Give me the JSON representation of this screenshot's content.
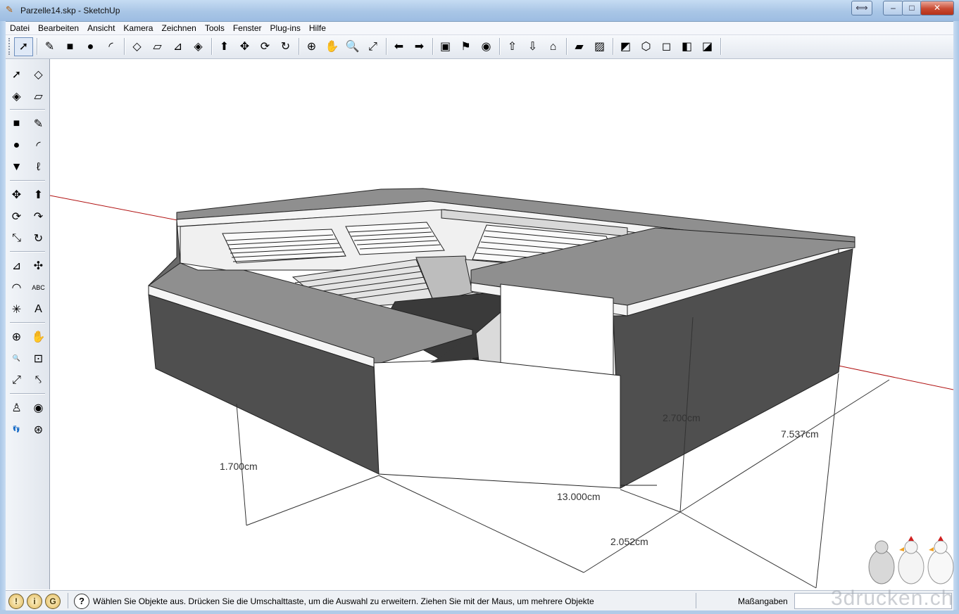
{
  "window": {
    "title": "Parzelle14.skp - SketchUp",
    "extra_button": "⟺",
    "minimize": "–",
    "maximize": "□",
    "close": "✕"
  },
  "menu": [
    "Datei",
    "Bearbeiten",
    "Ansicht",
    "Kamera",
    "Zeichnen",
    "Tools",
    "Fenster",
    "Plug-ins",
    "Hilfe"
  ],
  "toolbar": {
    "groups": [
      [
        {
          "name": "select-tool",
          "glyph": "➚"
        }
      ],
      [
        {
          "name": "pencil-tool",
          "glyph": "✎"
        },
        {
          "name": "rectangle-tool",
          "glyph": "■"
        },
        {
          "name": "circle-tool",
          "glyph": "●"
        },
        {
          "name": "arc-tool",
          "glyph": "◜"
        }
      ],
      [
        {
          "name": "make-component-tool",
          "glyph": "◇"
        },
        {
          "name": "eraser-tool",
          "glyph": "▱"
        },
        {
          "name": "tape-measure-tool",
          "glyph": "⊿"
        },
        {
          "name": "paint-bucket-tool",
          "glyph": "◈"
        }
      ],
      [
        {
          "name": "push-pull-tool",
          "glyph": "⬆"
        },
        {
          "name": "move-tool",
          "glyph": "✥"
        },
        {
          "name": "rotate-tool",
          "glyph": "⟳"
        },
        {
          "name": "offset-tool",
          "glyph": "↻"
        }
      ],
      [
        {
          "name": "orbit-tool",
          "glyph": "⊕"
        },
        {
          "name": "pan-tool",
          "glyph": "✋"
        },
        {
          "name": "zoom-tool",
          "glyph": "🔍"
        },
        {
          "name": "zoom-extents-tool",
          "glyph": "⤢"
        }
      ],
      [
        {
          "name": "previous-view-tool",
          "glyph": "⬅"
        },
        {
          "name": "next-view-tool",
          "glyph": "➡"
        }
      ],
      [
        {
          "name": "get-models-tool",
          "glyph": "▣"
        },
        {
          "name": "add-location-tool",
          "glyph": "⚑"
        },
        {
          "name": "google-earth-tool",
          "glyph": "◉"
        }
      ],
      [
        {
          "name": "share-model-tool",
          "glyph": "⇧"
        },
        {
          "name": "get-components-tool",
          "glyph": "⇩"
        },
        {
          "name": "share-component-tool",
          "glyph": "⌂"
        }
      ],
      [
        {
          "name": "section-plane-tool",
          "glyph": "▰"
        },
        {
          "name": "display-section-tool",
          "glyph": "▨"
        }
      ],
      [
        {
          "name": "xray-style-tool",
          "glyph": "◩"
        },
        {
          "name": "wireframe-style-tool",
          "glyph": "⬡"
        },
        {
          "name": "hidden-line-style-tool",
          "glyph": "◻"
        },
        {
          "name": "shaded-style-tool",
          "glyph": "◧"
        },
        {
          "name": "textured-style-tool",
          "glyph": "◪"
        }
      ]
    ]
  },
  "left_toolbar": [
    {
      "name": "select-tool",
      "glyph": "➚"
    },
    {
      "name": "make-component-tool",
      "glyph": "◇"
    },
    {
      "name": "paint-bucket-tool",
      "glyph": "◈"
    },
    {
      "name": "eraser-tool",
      "glyph": "▱"
    },
    {
      "name": "rectangle-tool",
      "glyph": "■"
    },
    {
      "name": "line-tool",
      "glyph": "✎"
    },
    {
      "name": "circle-tool",
      "glyph": "●"
    },
    {
      "name": "arc-tool",
      "glyph": "◜"
    },
    {
      "name": "polygon-tool",
      "glyph": "▼"
    },
    {
      "name": "freehand-tool",
      "glyph": "ℓ"
    },
    {
      "name": "move-tool",
      "glyph": "✥"
    },
    {
      "name": "push-pull-tool",
      "glyph": "⬆"
    },
    {
      "name": "rotate-tool",
      "glyph": "⟳"
    },
    {
      "name": "follow-me-tool",
      "glyph": "↷"
    },
    {
      "name": "scale-tool",
      "glyph": "⤡"
    },
    {
      "name": "offset-tool",
      "glyph": "↻"
    },
    {
      "name": "tape-measure-tool",
      "glyph": "⊿"
    },
    {
      "name": "dimension-tool",
      "glyph": "✣"
    },
    {
      "name": "protractor-tool",
      "glyph": "◠"
    },
    {
      "name": "text-tool",
      "glyph": "ABC"
    },
    {
      "name": "axes-tool",
      "glyph": "✳"
    },
    {
      "name": "3d-text-tool",
      "glyph": "A"
    },
    {
      "name": "orbit-tool",
      "glyph": "⊕"
    },
    {
      "name": "pan-tool",
      "glyph": "✋"
    },
    {
      "name": "zoom-tool",
      "glyph": "🔍"
    },
    {
      "name": "zoom-window-tool",
      "glyph": "⊡"
    },
    {
      "name": "zoom-extents-tool",
      "glyph": "⤢"
    },
    {
      "name": "previous-tool",
      "glyph": "⤣"
    },
    {
      "name": "position-camera-tool",
      "glyph": "♙"
    },
    {
      "name": "look-around-tool",
      "glyph": "◉"
    },
    {
      "name": "walk-tool",
      "glyph": "👣"
    },
    {
      "name": "section-plane-tool",
      "glyph": "⊛"
    }
  ],
  "dimensions": {
    "height_left": "1.700cm",
    "height_right": "2.700cm",
    "width_front": "13.000cm",
    "depth_right": "7.537cm",
    "small_depth": "2.052cm"
  },
  "status": {
    "message": "Wählen Sie Objekte aus. Drücken Sie die Umschalttaste, um die Auswahl zu erweitern. Ziehen Sie mit der Maus, um mehrere Objekte",
    "measurements_label": "Maßangaben",
    "geo_icon": "!",
    "credits_icon": "i",
    "user_icon": "G",
    "help_icon": "?"
  },
  "watermark": "3drucken.ch",
  "colors": {
    "top_face": "#8f8f8f",
    "dark_face": "#505050",
    "light_face": "#f0f0f0",
    "white_face": "#ffffff",
    "axis_red": "#b01010"
  }
}
